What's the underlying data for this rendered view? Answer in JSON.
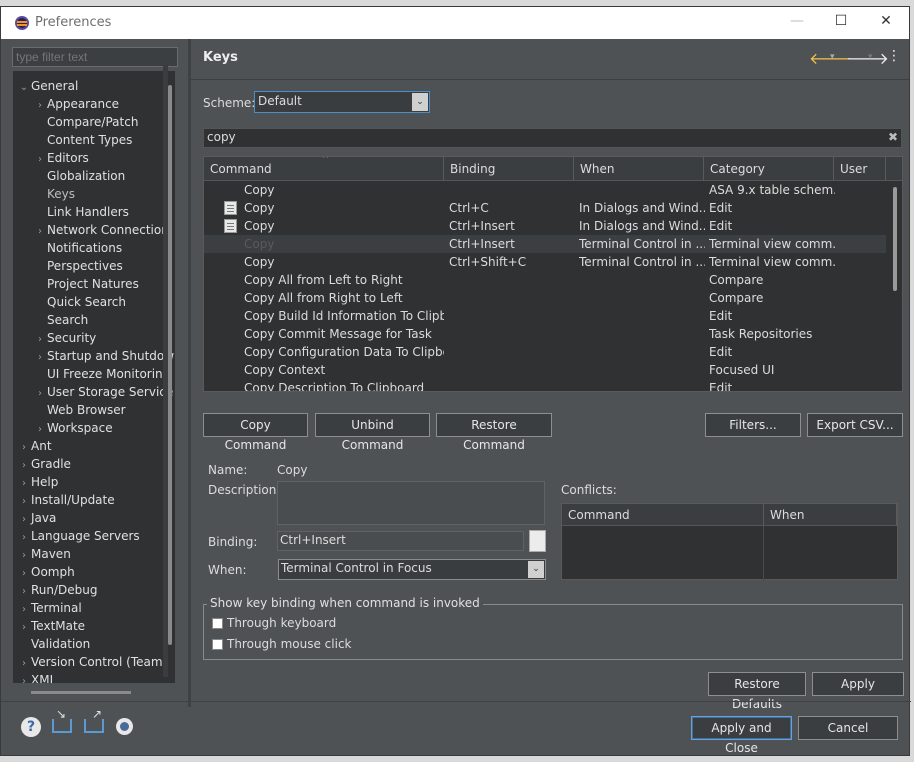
{
  "window": {
    "title": "Preferences",
    "minimize": "—",
    "maximize": "☐",
    "close": "✕"
  },
  "sidebar": {
    "filter_placeholder": "type filter text",
    "items": [
      {
        "label": "General",
        "toggle": "⌄"
      },
      {
        "label": "Appearance",
        "toggle": "›"
      },
      {
        "label": "Compare/Patch",
        "toggle": ""
      },
      {
        "label": "Content Types",
        "toggle": ""
      },
      {
        "label": "Editors",
        "toggle": "›"
      },
      {
        "label": "Globalization",
        "toggle": ""
      },
      {
        "label": "Keys",
        "toggle": ""
      },
      {
        "label": "Link Handlers",
        "toggle": ""
      },
      {
        "label": "Network Connection",
        "toggle": "›"
      },
      {
        "label": "Notifications",
        "toggle": ""
      },
      {
        "label": "Perspectives",
        "toggle": ""
      },
      {
        "label": "Project Natures",
        "toggle": ""
      },
      {
        "label": "Quick Search",
        "toggle": ""
      },
      {
        "label": "Search",
        "toggle": ""
      },
      {
        "label": "Security",
        "toggle": "›"
      },
      {
        "label": "Startup and Shutdow",
        "toggle": "›"
      },
      {
        "label": "UI Freeze Monitoring",
        "toggle": ""
      },
      {
        "label": "User Storage Service",
        "toggle": "›"
      },
      {
        "label": "Web Browser",
        "toggle": ""
      },
      {
        "label": "Workspace",
        "toggle": "›"
      },
      {
        "label": "Ant",
        "toggle": "›"
      },
      {
        "label": "Gradle",
        "toggle": "›"
      },
      {
        "label": "Help",
        "toggle": "›"
      },
      {
        "label": "Install/Update",
        "toggle": "›"
      },
      {
        "label": "Java",
        "toggle": "›"
      },
      {
        "label": "Language Servers",
        "toggle": "›"
      },
      {
        "label": "Maven",
        "toggle": "›"
      },
      {
        "label": "Oomph",
        "toggle": "›"
      },
      {
        "label": "Run/Debug",
        "toggle": "›"
      },
      {
        "label": "Terminal",
        "toggle": "›"
      },
      {
        "label": "TextMate",
        "toggle": "›"
      },
      {
        "label": "Validation",
        "toggle": ""
      },
      {
        "label": "Version Control (Team)",
        "toggle": "›"
      },
      {
        "label": "XML",
        "toggle": "›"
      }
    ]
  },
  "header": {
    "title": "Keys",
    "back": "🡐",
    "forward": "🡒",
    "dropdown": "▾",
    "menu": "⋮"
  },
  "scheme": {
    "label": "Scheme:",
    "value": "Default",
    "dropdown": "⌄"
  },
  "search": {
    "value": "copy",
    "clear": "✖"
  },
  "bindings_table": {
    "columns": [
      "Command",
      "Binding",
      "When",
      "Category",
      "User"
    ],
    "sort_indicator": "^",
    "rows": [
      {
        "command": "Copy",
        "binding": "",
        "when": "",
        "category": "ASA 9.x table schem...",
        "icon": false
      },
      {
        "command": "Copy",
        "binding": "Ctrl+C",
        "when": "In Dialogs and Wind...",
        "category": "Edit",
        "icon": true
      },
      {
        "command": "Copy",
        "binding": "Ctrl+Insert",
        "when": "In Dialogs and Wind...",
        "category": "Edit",
        "icon": true
      },
      {
        "command": "Copy",
        "binding": "Ctrl+Insert",
        "when": "Terminal Control in ...",
        "category": "Terminal view comm...",
        "icon": false
      },
      {
        "command": "Copy",
        "binding": "Ctrl+Shift+C",
        "when": "Terminal Control in ...",
        "category": "Terminal view comm...",
        "icon": false
      },
      {
        "command": "Copy All from Left to Right",
        "binding": "",
        "when": "",
        "category": "Compare",
        "icon": false
      },
      {
        "command": "Copy All from Right to Left",
        "binding": "",
        "when": "",
        "category": "Compare",
        "icon": false
      },
      {
        "command": "Copy Build Id Information To Clipboard",
        "binding": "",
        "when": "",
        "category": "Edit",
        "icon": false
      },
      {
        "command": "Copy Commit Message for Task",
        "binding": "",
        "when": "",
        "category": "Task Repositories",
        "icon": false
      },
      {
        "command": "Copy Configuration Data To Clipboard",
        "binding": "",
        "when": "",
        "category": "Edit",
        "icon": false
      },
      {
        "command": "Copy Context",
        "binding": "",
        "when": "",
        "category": "Focused UI",
        "icon": false
      },
      {
        "command": "Copy Description To Clipboard",
        "binding": "",
        "when": "",
        "category": "Edit",
        "icon": false
      }
    ],
    "selected_row": 3
  },
  "buttons": {
    "copy_command": "Copy Command",
    "unbind_command": "Unbind Command",
    "restore_command": "Restore Command",
    "filters": "Filters...",
    "export_csv": "Export CSV...",
    "restore_defaults": "Restore Defaults",
    "apply": "Apply",
    "apply_and_close": "Apply and Close",
    "cancel": "Cancel"
  },
  "details": {
    "name_label": "Name:",
    "name_value": "Copy",
    "description_label": "Description:",
    "binding_label": "Binding:",
    "binding_value": "Ctrl+Insert",
    "when_label": "When:",
    "when_value": "Terminal Control in Focus",
    "when_dropdown": "⌄"
  },
  "conflicts": {
    "label": "Conflicts:",
    "columns": [
      "Command",
      "When"
    ]
  },
  "show_binding_group": {
    "legend": "Show key binding when command is invoked",
    "through_keyboard": "Through keyboard",
    "through_mouse": "Through mouse click",
    "through_keyboard_checked": false,
    "through_mouse_checked": false
  },
  "footer_icons": {
    "help": "?"
  }
}
